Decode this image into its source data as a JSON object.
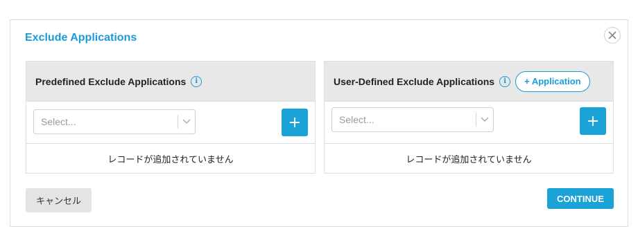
{
  "dialog": {
    "title": "Exclude Applications",
    "close_icon": "close-icon"
  },
  "predefined": {
    "title": "Predefined Exclude Applications",
    "info_icon": "info-icon",
    "select_placeholder": "Select...",
    "empty_text": "レコードが追加されていません"
  },
  "user_defined": {
    "title": "User-Defined Exclude Applications",
    "info_icon": "info-icon",
    "add_application_label": "+ Application",
    "select_placeholder": "Select...",
    "empty_text": "レコードが追加されていません"
  },
  "footer": {
    "cancel_label": "キャンセル",
    "continue_label": "CONTINUE"
  },
  "colors": {
    "accent": "#1a9bd7",
    "panel_header": "#e8e8e8",
    "cancel_bg": "#e4e4e4"
  }
}
